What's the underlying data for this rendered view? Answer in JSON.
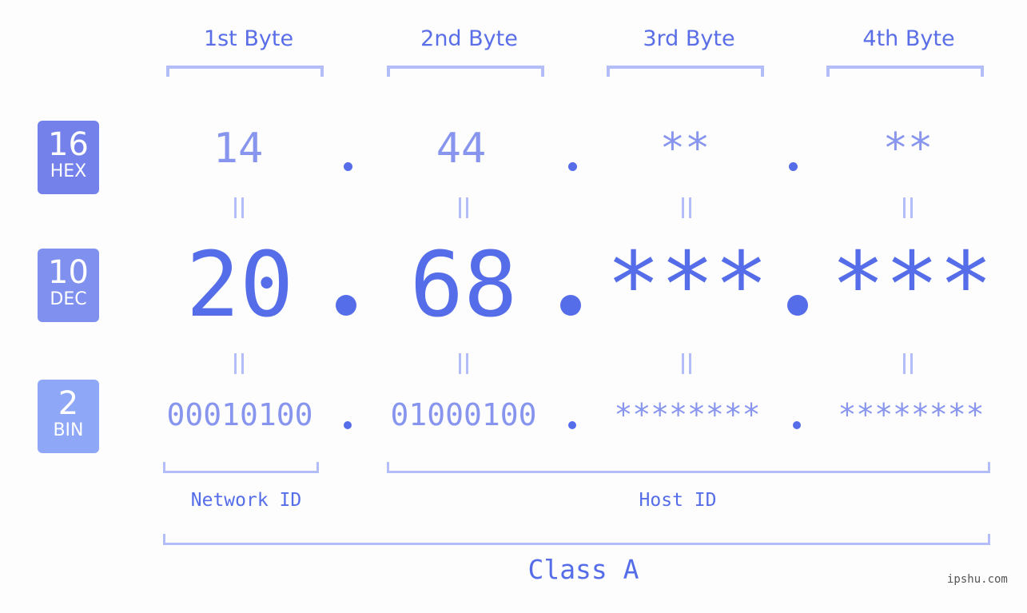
{
  "bytes": {
    "headers": [
      "1st Byte",
      "2nd Byte",
      "3rd Byte",
      "4th Byte"
    ]
  },
  "rows": {
    "hex": {
      "base": "16",
      "label": "HEX",
      "values": [
        "14",
        "44",
        "**",
        "**"
      ],
      "color": "#7481ea"
    },
    "dec": {
      "base": "10",
      "label": "DEC",
      "values": [
        "20",
        "68",
        "***",
        "***"
      ],
      "color": "#8090ef"
    },
    "bin": {
      "base": "2",
      "label": "BIN",
      "values": [
        "00010100",
        "01000100",
        "********",
        "********"
      ],
      "color": "#8fa7f7"
    }
  },
  "sections": {
    "network_id": "Network ID",
    "host_id": "Host ID",
    "class": "Class A"
  },
  "watermark": "ipshu.com",
  "colors": {
    "accent": "#566de9",
    "light_value": "#8795ee",
    "bracket": "#b3bdf7"
  }
}
